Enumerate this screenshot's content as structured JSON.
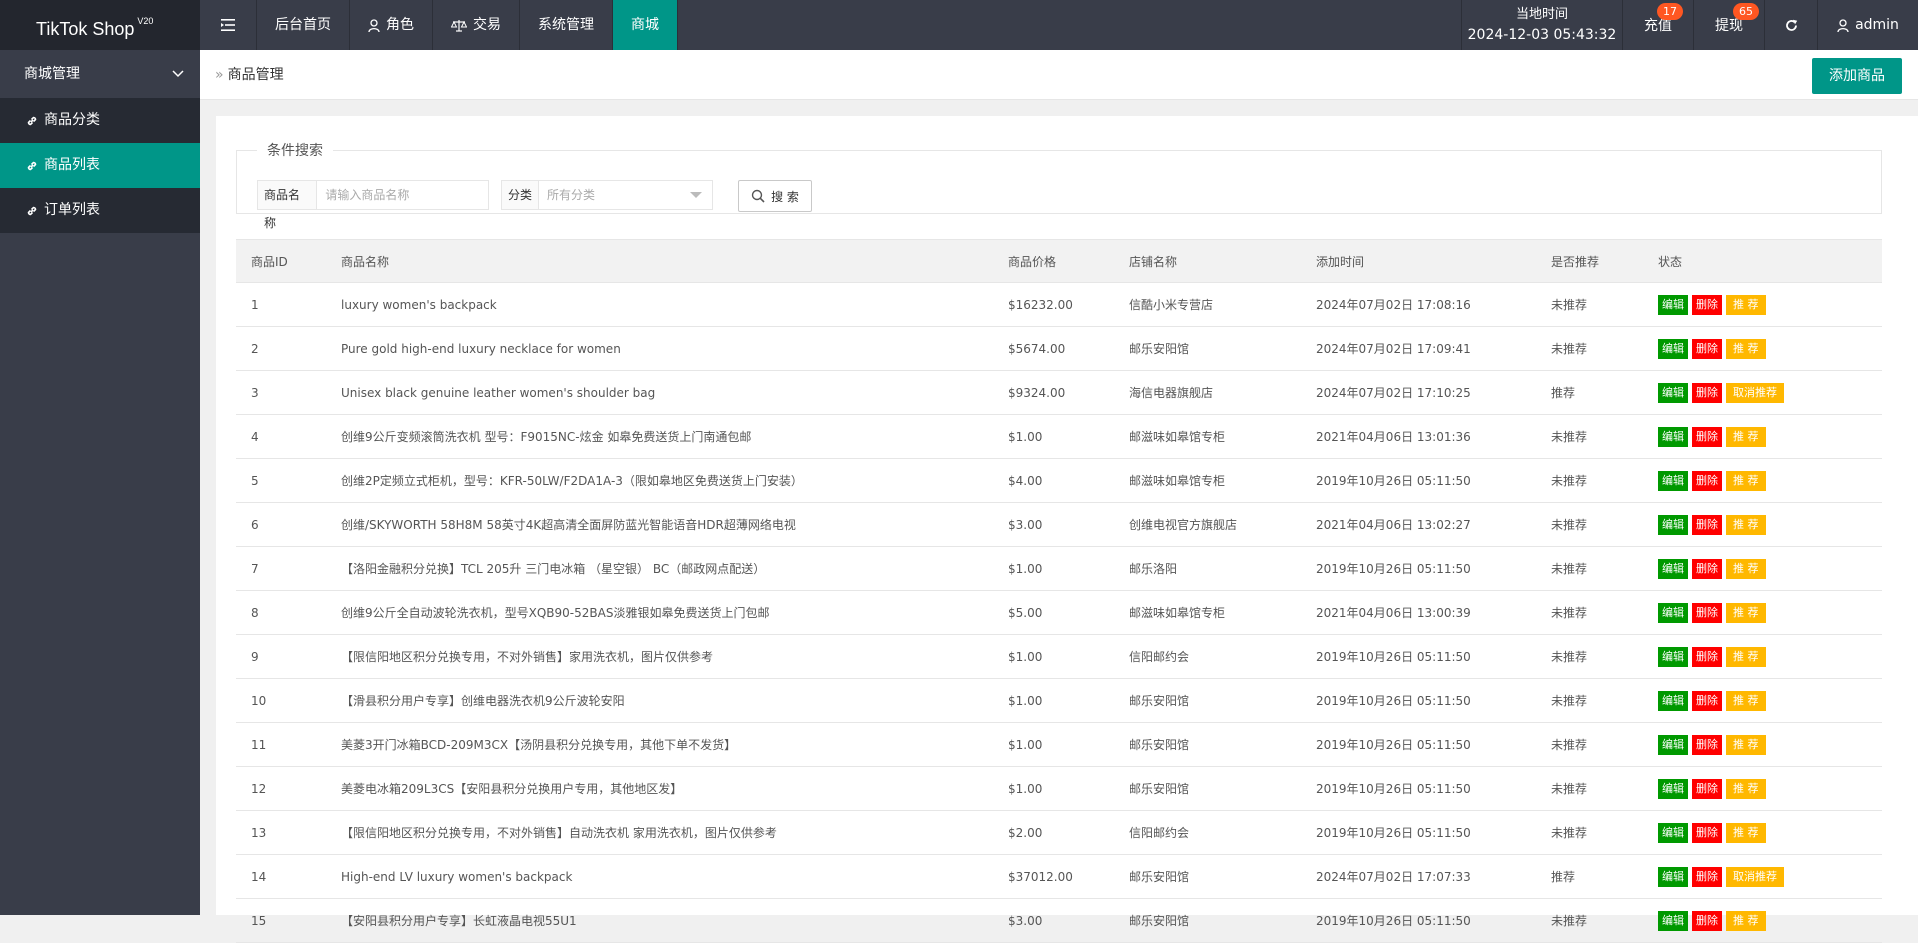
{
  "app": {
    "name": "TikTok Shop",
    "version": "V20"
  },
  "topnav": {
    "items": [
      {
        "label": "后台首页"
      },
      {
        "label": "角色"
      },
      {
        "label": "交易"
      },
      {
        "label": "系统管理"
      },
      {
        "label": "商城"
      }
    ],
    "active_index": 4
  },
  "topright": {
    "clock_label": "当地时间",
    "clock_value": "2024-12-03 05:43:32",
    "recharge": "充值",
    "recharge_badge": "17",
    "withdraw": "提现",
    "withdraw_badge": "65",
    "user": "admin"
  },
  "sidebar": {
    "group": "商城管理",
    "items": [
      {
        "label": "商品分类"
      },
      {
        "label": "商品列表"
      },
      {
        "label": "订单列表"
      }
    ],
    "active_index": 1
  },
  "breadcrumb": {
    "current": "商品管理"
  },
  "add_button": "添加商品",
  "search": {
    "legend": "条件搜索",
    "name_label": "商品名称",
    "name_placeholder": "请输入商品名称",
    "category_label": "分类",
    "category_value": "所有分类",
    "button": "搜 索"
  },
  "table": {
    "headers": [
      "商品ID",
      "商品名称",
      "商品价格",
      "店铺名称",
      "添加时间",
      "是否推荐",
      "状态"
    ],
    "action_labels": {
      "edit": "编辑",
      "delete": "删除",
      "recommend": "推 荐",
      "cancel_recommend": "取消推荐"
    },
    "rows": [
      {
        "id": "1",
        "name": "luxury women's backpack",
        "price": "$16232.00",
        "shop": "信酷小米专营店",
        "time": "2024年07月02日 17:08:16",
        "rec": "未推荐"
      },
      {
        "id": "2",
        "name": "Pure gold high-end luxury necklace for women",
        "price": "$5674.00",
        "shop": "邮乐安阳馆",
        "time": "2024年07月02日 17:09:41",
        "rec": "未推荐"
      },
      {
        "id": "3",
        "name": "Unisex black genuine leather women's shoulder bag",
        "price": "$9324.00",
        "shop": "海信电器旗舰店",
        "time": "2024年07月02日 17:10:25",
        "rec": "推荐"
      },
      {
        "id": "4",
        "name": "创维9公斤变频滚筒洗衣机 型号：F9015NC-炫金 如皋免费送货上门南通包邮",
        "price": "$1.00",
        "shop": "邮滋味如皋馆专柜",
        "time": "2021年04月06日 13:01:36",
        "rec": "未推荐"
      },
      {
        "id": "5",
        "name": "创维2P定频立式柜机，型号：KFR-50LW/F2DA1A-3（限如皋地区免费送货上门安装）",
        "price": "$4.00",
        "shop": "邮滋味如皋馆专柜",
        "time": "2019年10月26日 05:11:50",
        "rec": "未推荐"
      },
      {
        "id": "6",
        "name": "创维/SKYWORTH 58H8M 58英寸4K超高清全面屏防蓝光智能语音HDR超薄网络电视",
        "price": "$3.00",
        "shop": "创维电视官方旗舰店",
        "time": "2021年04月06日 13:02:27",
        "rec": "未推荐"
      },
      {
        "id": "7",
        "name": "【洛阳金融积分兑换】TCL 205升 三门电冰箱 （星空银） BC（邮政网点配送）",
        "price": "$1.00",
        "shop": "邮乐洛阳",
        "time": "2019年10月26日 05:11:50",
        "rec": "未推荐"
      },
      {
        "id": "8",
        "name": "创维9公斤全自动波轮洗衣机，型号XQB90-52BAS淡雅银如皋免费送货上门包邮",
        "price": "$5.00",
        "shop": "邮滋味如皋馆专柜",
        "time": "2021年04月06日 13:00:39",
        "rec": "未推荐"
      },
      {
        "id": "9",
        "name": "【限信阳地区积分兑换专用，不对外销售】家用洗衣机，图片仅供参考",
        "price": "$1.00",
        "shop": "信阳邮约会",
        "time": "2019年10月26日 05:11:50",
        "rec": "未推荐"
      },
      {
        "id": "10",
        "name": "【滑县积分用户专享】创维电器洗衣机9公斤波轮安阳",
        "price": "$1.00",
        "shop": "邮乐安阳馆",
        "time": "2019年10月26日 05:11:50",
        "rec": "未推荐"
      },
      {
        "id": "11",
        "name": "美菱3开门冰箱BCD-209M3CX【汤阴县积分兑换专用，其他下单不发货】",
        "price": "$1.00",
        "shop": "邮乐安阳馆",
        "time": "2019年10月26日 05:11:50",
        "rec": "未推荐"
      },
      {
        "id": "12",
        "name": "美菱电冰箱209L3CS【安阳县积分兑换用户专用，其他地区发】",
        "price": "$1.00",
        "shop": "邮乐安阳馆",
        "time": "2019年10月26日 05:11:50",
        "rec": "未推荐"
      },
      {
        "id": "13",
        "name": "【限信阳地区积分兑换专用，不对外销售】自动洗衣机 家用洗衣机，图片仅供参考",
        "price": "$2.00",
        "shop": "信阳邮约会",
        "time": "2019年10月26日 05:11:50",
        "rec": "未推荐"
      },
      {
        "id": "14",
        "name": "High-end LV luxury women's backpack",
        "price": "$37012.00",
        "shop": "邮乐安阳馆",
        "time": "2024年07月02日 17:07:33",
        "rec": "推荐"
      },
      {
        "id": "15",
        "name": "【安阳县积分用户专享】长虹液晶电视55U1",
        "price": "$3.00",
        "shop": "邮乐安阳馆",
        "time": "2019年10月26日 05:11:50",
        "rec": "未推荐"
      }
    ]
  },
  "colors": {
    "accent": "#009688",
    "topbar": "#393d49",
    "edit": "#009900",
    "delete": "#ff0000",
    "recommend": "#ffb800"
  }
}
